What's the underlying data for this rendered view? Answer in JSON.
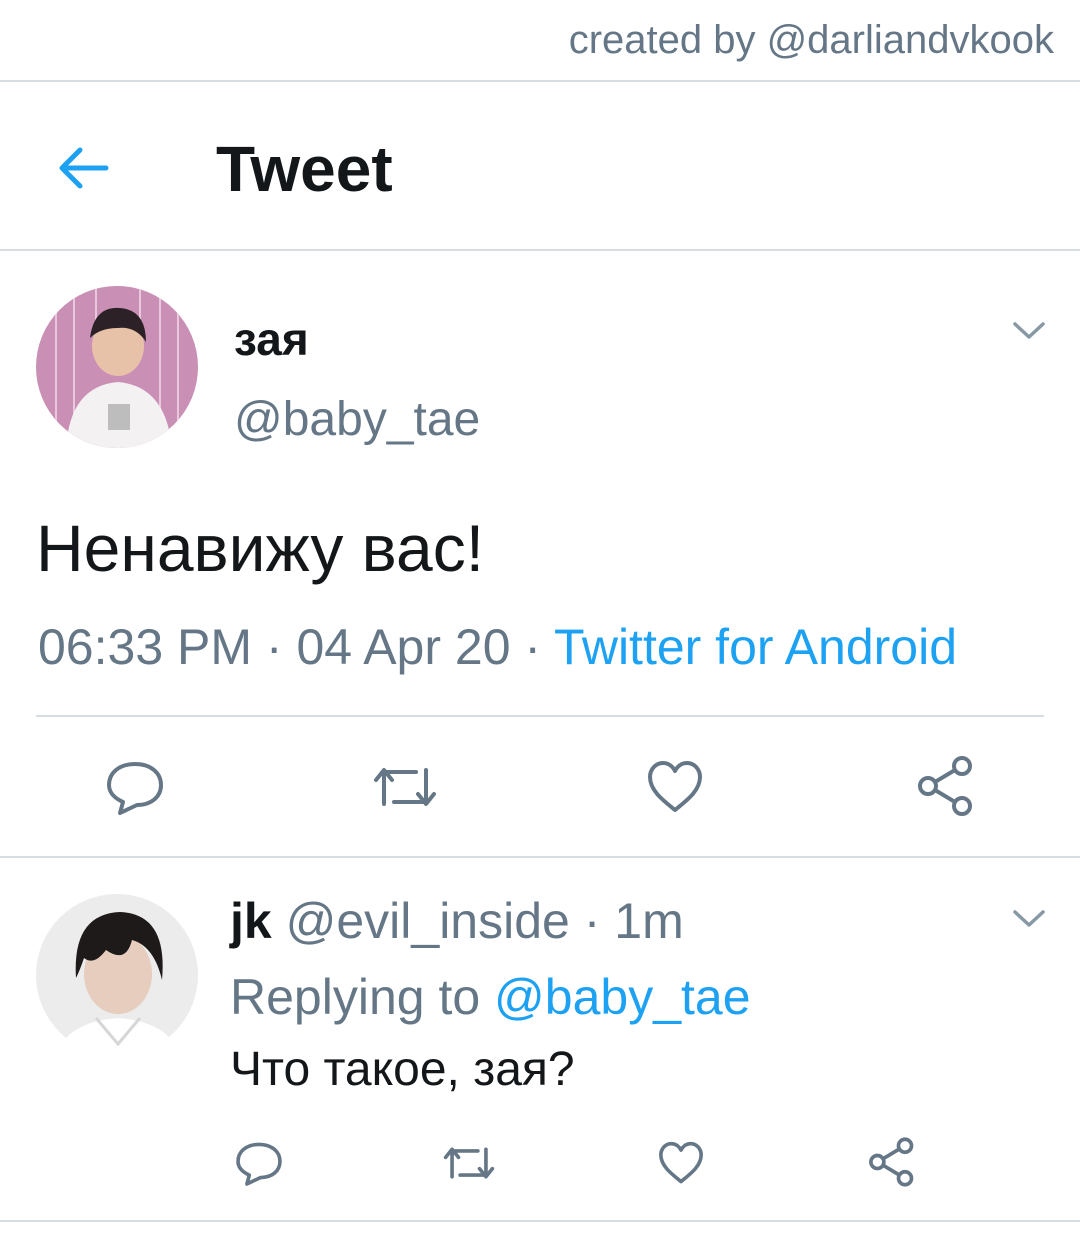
{
  "credit": "created by @darliandvkook",
  "header": {
    "title": "Tweet"
  },
  "tweet": {
    "name": "зая",
    "handle": "@baby_tae",
    "text": "Ненавижу вас!",
    "time": "06:33 PM",
    "sep1": " · ",
    "date": "04 Apr 20",
    "sep2": " · ",
    "source": "Twitter for Android"
  },
  "reply": {
    "name": "jk",
    "handle": "@evil_inside",
    "age": " · 1m",
    "replying_prefix": "Replying to ",
    "replying_handle": "@baby_tae",
    "text": "Что такое, зая?"
  },
  "colors": {
    "accent": "#1da1f2",
    "muted": "#657786",
    "divider": "#d6dde3"
  }
}
